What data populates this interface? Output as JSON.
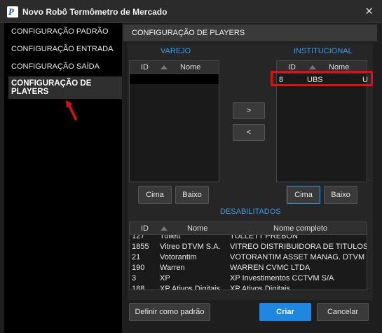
{
  "window": {
    "title": "Novo Robô Termômetro de Mercado",
    "logo_letter": "P",
    "close_glyph": "✕"
  },
  "sidebar": {
    "items": [
      {
        "label": "CONFIGURAÇÃO PADRÃO"
      },
      {
        "label": "CONFIGURAÇÃO ENTRADA"
      },
      {
        "label": "CONFIGURAÇÃO SAÍDA"
      },
      {
        "label": "CONFIGURAÇÃO DE PLAYERS",
        "active": true
      }
    ]
  },
  "section": {
    "title": "CONFIGURAÇÃO DE PLAYERS"
  },
  "varejo": {
    "label": "VAREJO",
    "col_id": "ID",
    "col_nome": "Nome"
  },
  "institucional": {
    "label": "INSTITUCIONAL",
    "col_id": "ID",
    "col_nome": "Nome",
    "rows": [
      {
        "id": "8",
        "nome": "UBS",
        "extra": "U"
      }
    ]
  },
  "transfer": {
    "right": ">",
    "left": "<"
  },
  "varejo_buttons": {
    "up": "Cima",
    "down": "Baixo"
  },
  "inst_buttons": {
    "up": "Cima",
    "down": "Baixo"
  },
  "desabilitados": {
    "label": "DESABILITADOS",
    "col_id": "ID",
    "col_nome": "Nome",
    "col_full": "Nome completo",
    "rows": [
      {
        "id": "127",
        "nome": "Tullett",
        "full": "TULLETT PREBON"
      },
      {
        "id": "1855",
        "nome": "Vitreo DTVM S.A.",
        "full": "VITREO DISTRIBUIDORA DE TITULOS ..."
      },
      {
        "id": "21",
        "nome": "Votorantim",
        "full": "VOTORANTIM ASSET MANAG. DTVM"
      },
      {
        "id": "190",
        "nome": "Warren",
        "full": "WARREN CVMC LTDA"
      },
      {
        "id": "3",
        "nome": "XP",
        "full": "XP Investimentos CCTVM S/A"
      },
      {
        "id": "188",
        "nome": "XP Ativos Digitais",
        "full": "XP Ativos Digitais"
      }
    ]
  },
  "footer": {
    "default_label": "Definir como padrão",
    "create_label": "Criar",
    "cancel_label": "Cancelar"
  },
  "colors": {
    "accent": "#1f87e0",
    "label_blue": "#3a9be8",
    "highlight_red": "#e01010"
  }
}
